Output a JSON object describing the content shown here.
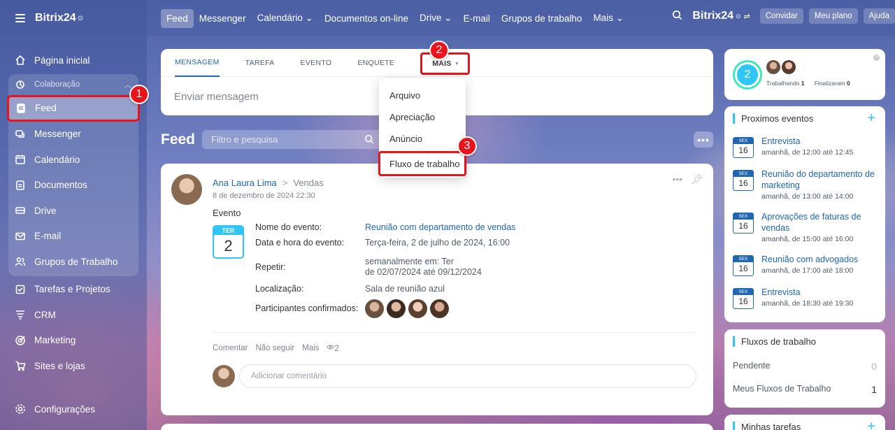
{
  "app": {
    "logo": "Bitrix24",
    "logo_mark": "⊙"
  },
  "sidebar": {
    "items_top": [
      {
        "label": "Página inicial",
        "icon": "home-icon"
      }
    ],
    "group": {
      "label": "Colaboração",
      "items": [
        {
          "label": "Feed",
          "icon": "feed-icon",
          "active": true
        },
        {
          "label": "Messenger",
          "icon": "chat-icon"
        },
        {
          "label": "Calendário",
          "icon": "calendar-icon"
        },
        {
          "label": "Documentos",
          "icon": "document-icon"
        },
        {
          "label": "Drive",
          "icon": "drive-icon"
        },
        {
          "label": "E-mail",
          "icon": "mail-icon"
        },
        {
          "label": "Grupos de Trabalho",
          "icon": "groups-icon"
        }
      ]
    },
    "items_bottom": [
      {
        "label": "Tarefas e Projetos",
        "icon": "tasks-icon"
      },
      {
        "label": "CRM",
        "icon": "crm-icon"
      },
      {
        "label": "Marketing",
        "icon": "marketing-icon"
      },
      {
        "label": "Sites e lojas",
        "icon": "cart-icon"
      }
    ],
    "settings": "Configurações"
  },
  "topnav": {
    "items": [
      "Feed",
      "Messenger",
      "Calendário ⌄",
      "Documentos on-line",
      "Drive ⌄",
      "E-mail",
      "Grupos de trabalho",
      "Mais ⌄"
    ],
    "logo": "Bitrix",
    "logo_num": "24",
    "buttons": [
      "Convidar",
      "Meu plano",
      "Ajuda"
    ]
  },
  "composer": {
    "tabs": [
      "MENSAGEM",
      "TAREFA",
      "EVENTO",
      "ENQUETE"
    ],
    "more_tab": "MAIS",
    "placeholder": "Enviar mensagem"
  },
  "dropdown": {
    "items": [
      "Arquivo",
      "Apreciação",
      "Anúncio"
    ],
    "highlighted": "Fluxo de trabalho"
  },
  "feed": {
    "title": "Feed",
    "filter_placeholder": "Filtro e pesquisa",
    "more": "•••"
  },
  "post": {
    "author": "Ana Laura Lima",
    "destination": "Vendas",
    "date": "8 de dezembro de 2024 22:30",
    "type": "Evento",
    "cal_weekday": "TER",
    "cal_day": "2",
    "fields": {
      "name_label": "Nome do evento:",
      "name_value": "Reunião com departamento de vendas",
      "datetime_label": "Data e hora do evento:",
      "datetime_value": "Terça-feira, 2 de julho de 2024, 16:00",
      "repeat_label": "Repetir:",
      "repeat_line1": "semanalmente em: Ter",
      "repeat_line2": "de 02/07/2024 até 09/12/2024",
      "location_label": "Localização:",
      "location_value": "Sala de reunião azul",
      "participants_label": "Participantes confirmados:"
    },
    "footer": {
      "comment": "Comentar",
      "unfollow": "Não seguir",
      "more": "Mais",
      "views": "2"
    },
    "comment_placeholder": "Adicionar comentário"
  },
  "widgets": {
    "work": {
      "count": "2",
      "working_label": "Trabalhando",
      "working_value": "1",
      "finished_label": "Finalizaram",
      "finished_value": "0"
    },
    "events": {
      "title": "Proximos eventos",
      "items": [
        {
          "weekday": "SEX",
          "day": "16",
          "name": "Entrevista",
          "time": "amanhã, de 12:00 até 12:45"
        },
        {
          "weekday": "SEX",
          "day": "16",
          "name": "Reunião do departamento de marketing",
          "time": "amanhã, de 13:00 até 14:00"
        },
        {
          "weekday": "SEX",
          "day": "16",
          "name": "Aprovações de faturas de vendas",
          "time": "amanhã, de 15:00 até 16:00"
        },
        {
          "weekday": "SEX",
          "day": "16",
          "name": "Reunião com advogados",
          "time": "amanhã, de 17:00 até 18:00"
        },
        {
          "weekday": "SEX",
          "day": "16",
          "name": "Entrevista",
          "time": "amanhã, de 18:30 até 19:30"
        }
      ]
    },
    "flows": {
      "title": "Fluxos de trabalho",
      "pending_label": "Pendente",
      "pending_value": "0",
      "mine_label": "Meus Fluxos de Trabalho",
      "mine_value": "1"
    },
    "tasks": {
      "title": "Minhas tarefas"
    }
  },
  "badges": [
    "1",
    "2",
    "3"
  ],
  "colors": {
    "accent": "#2067b0",
    "highlight": "#e8141c",
    "calendar": "#2fc6f6"
  }
}
